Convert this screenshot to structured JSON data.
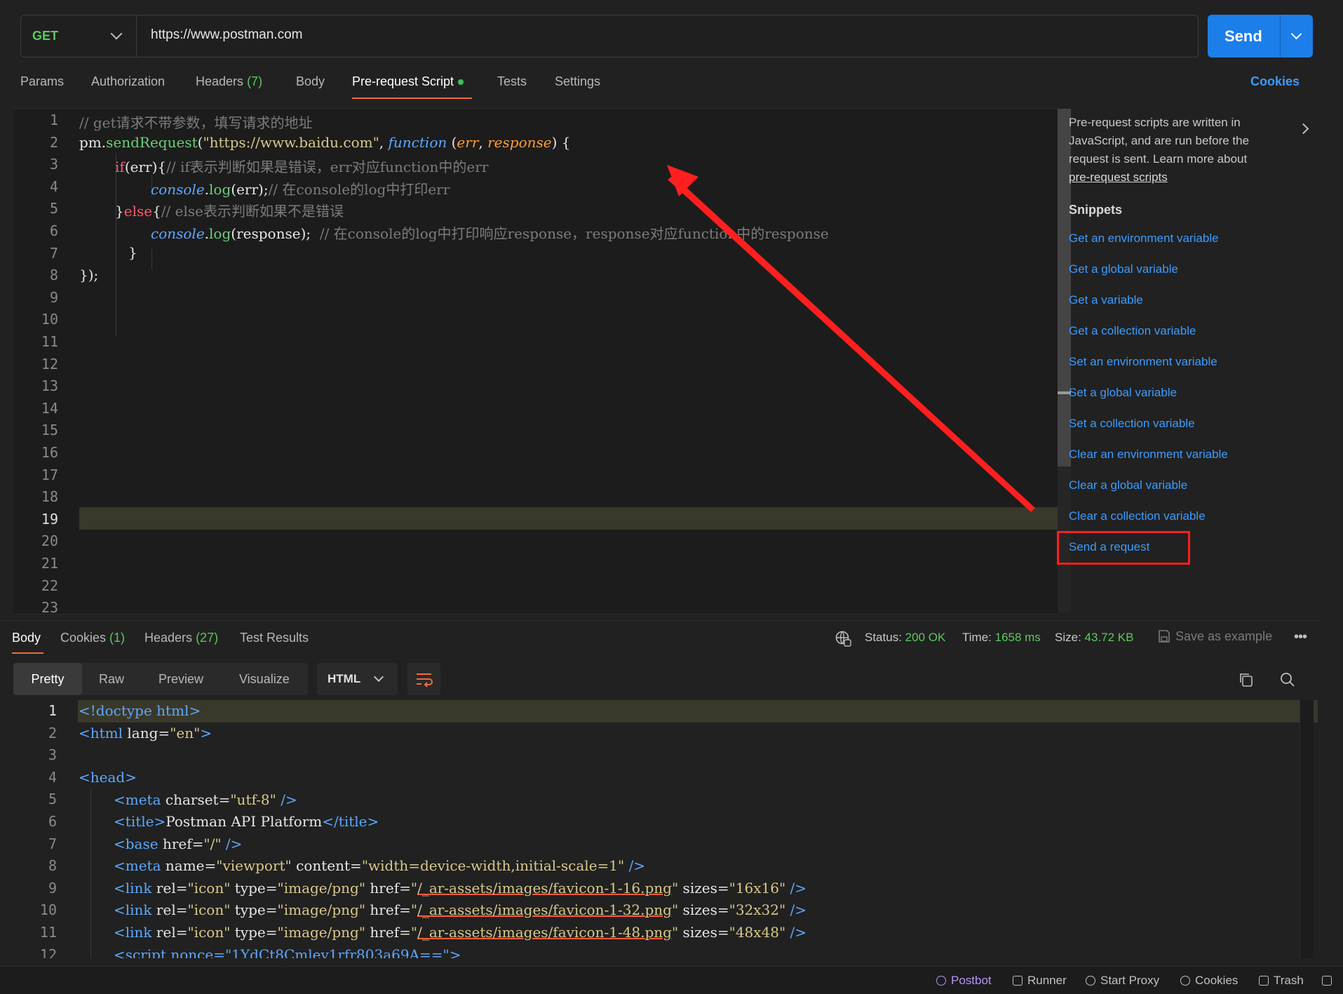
{
  "request": {
    "method": "GET",
    "url": "https://www.postman.com",
    "send_label": "Send"
  },
  "request_tabs": {
    "params": "Params",
    "authorization": "Authorization",
    "headers": "Headers",
    "headers_count": "(7)",
    "body": "Body",
    "prerequest": "Pre-request Script",
    "tests": "Tests",
    "settings": "Settings",
    "cookies": "Cookies"
  },
  "script": {
    "line_numbers": [
      "1",
      "2",
      "3",
      "4",
      "5",
      "6",
      "7",
      "8",
      "9",
      "10",
      "11",
      "12",
      "13",
      "14",
      "15",
      "16",
      "17",
      "18",
      "19",
      "20",
      "21",
      "22",
      "23"
    ],
    "l1_comment": "// get请求不带参数，填写请求的地址",
    "l2_pm": "pm.",
    "l2_fn": "sendRequest",
    "l2_open": "(",
    "l2_str": "\"https://www.baidu.com\"",
    "l2_comma": ", ",
    "l2_function": "function",
    "l2_paren": " (",
    "l2_err": "err",
    "l2_comma2": ", ",
    "l2_response": "response",
    "l2_close": ") {",
    "l3_if": "if",
    "l3_code": "(err){",
    "l3_comment": "// if表示判断如果是错误，err对应function中的err",
    "l4_console": "console",
    "l4_dot": ".",
    "l4_log": "log",
    "l4_args": "(err);",
    "l4_comment": "// 在console的log中打印err",
    "l5_brace": "}",
    "l5_else": "else",
    "l5_open": "{",
    "l5_comment": "// else表示判断如果不是错误",
    "l6_console": "console",
    "l6_dot": ".",
    "l6_log": "log",
    "l6_args": "(response);  ",
    "l6_comment": "// 在console的log中打印响应response，response对应function中的response",
    "l7": "}",
    "l8": "});"
  },
  "side_panel": {
    "description": "Pre-request scripts are written in JavaScript, and are run before the request is sent. Learn more about",
    "link": "pre-request scripts",
    "snippets_heading": "Snippets",
    "snippets": [
      "Get an environment variable",
      "Get a global variable",
      "Get a variable",
      "Get a collection variable",
      "Set an environment variable",
      "Set a global variable",
      "Set a collection variable",
      "Clear an environment variable",
      "Clear a global variable",
      "Clear a collection variable",
      "Send a request"
    ]
  },
  "response_tabs": {
    "body": "Body",
    "cookies": "Cookies",
    "cookies_count": "(1)",
    "headers": "Headers",
    "headers_count": "(27)",
    "test_results": "Test Results"
  },
  "response_status": {
    "status_label": "Status:",
    "status_value": "200 OK",
    "time_label": "Time:",
    "time_value": "1658 ms",
    "size_label": "Size:",
    "size_value": "43.72 KB",
    "save_example": "Save as example"
  },
  "view_modes": {
    "pretty": "Pretty",
    "raw": "Raw",
    "preview": "Preview",
    "visualize": "Visualize",
    "language": "HTML"
  },
  "response_body": {
    "line_numbers": [
      "1",
      "2",
      "3",
      "4",
      "5",
      "6",
      "7",
      "8",
      "9",
      "10",
      "11",
      "12"
    ],
    "r1": "<!doctype html>",
    "r2_tag": "<html",
    "r2_attr": " lang",
    "r2_eq": "=",
    "r2_val": "\"en\"",
    "r2_end": ">",
    "r4": "<head>",
    "r5_tag": "<meta",
    "r5_attr": " charset",
    "r5_eq": "=",
    "r5_val": "\"utf-8\"",
    "r5_end": " />",
    "r6_open": "<title>",
    "r6_text": "Postman API Platform",
    "r6_close": "</title>",
    "r7_tag": "<base",
    "r7_attr": " href",
    "r7_eq": "=",
    "r7_val": "\"/\"",
    "r7_end": " />",
    "r8_tag": "<meta",
    "r8_attr1": " name",
    "r8_val1": "\"viewport\"",
    "r8_attr2": " content",
    "r8_val2": "\"width=device-width,initial-scale=1\"",
    "r8_end": " />",
    "link_tag": "<link",
    "link_rel": " rel",
    "link_rel_val": "\"icon\"",
    "link_type": " type",
    "link_type_val": "\"image/png\"",
    "link_href": " href",
    "link_sizes": " sizes",
    "link_end": " />",
    "r9_href": "/_ar-assets/images/favicon-1-16.png",
    "r9_sizes": "\"16x16\"",
    "r10_href": "/_ar-assets/images/favicon-1-32.png",
    "r10_sizes": "\"32x32\"",
    "r11_href": "/_ar-assets/images/favicon-1-48.png",
    "r11_sizes": "\"48x48\"",
    "r12": "<script nonce=\"1YdCt8Cmlev1rfr803a69A==\">"
  },
  "footer": {
    "postbot": "Postbot",
    "runner": "Runner",
    "start_proxy": "Start Proxy",
    "cookies": "Cookies",
    "trash": "Trash"
  },
  "colors": {
    "accent_blue": "#1c7ee8",
    "method_green": "#5bc85b",
    "tab_underline": "#f26b3a",
    "annotation_red": "#ff1f1f"
  }
}
